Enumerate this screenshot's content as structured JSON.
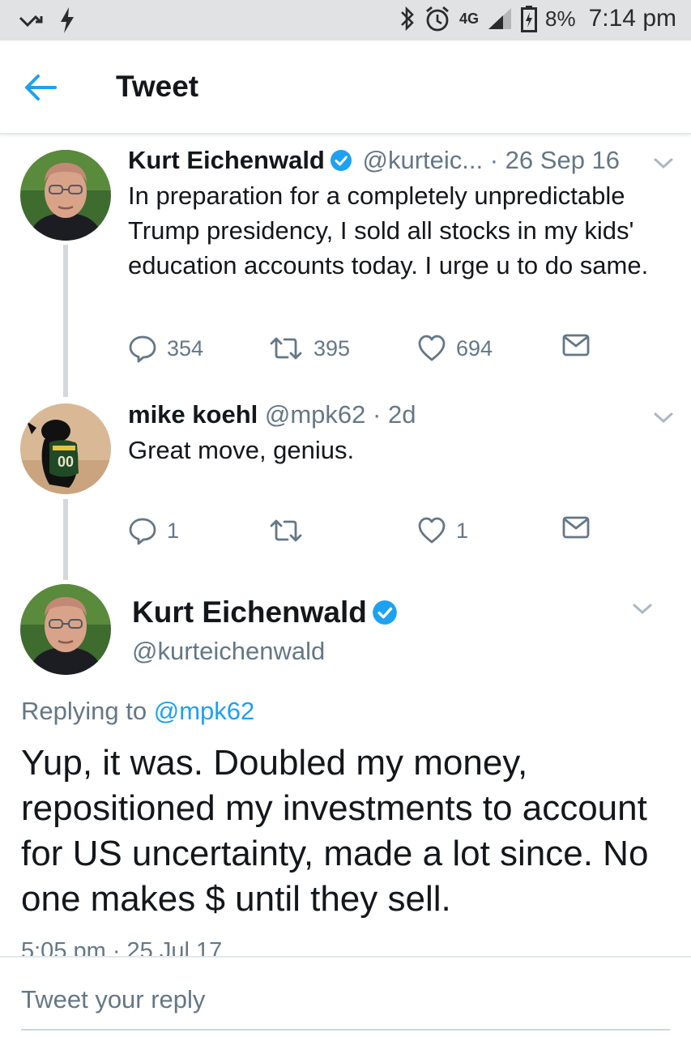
{
  "status_bar": {
    "network": "4G",
    "battery_percent": "8%",
    "time": "7:14 pm",
    "icons": [
      "missed-call-icon",
      "flash-icon",
      "bluetooth-icon",
      "alarm-icon",
      "signal-icon",
      "battery-icon"
    ]
  },
  "header": {
    "title": "Tweet",
    "back_icon": "arrow-left-icon"
  },
  "thread": [
    {
      "name": "Kurt Eichenwald",
      "verified": true,
      "handle": "@kurteic...",
      "date": "· 26 Sep 16",
      "text": "In preparation for a completely unpredictable Trump presidency, I sold all stocks in my kids' education accounts today. I urge u to do same.",
      "replies": "354",
      "retweets": "395",
      "likes": "694"
    },
    {
      "name": "mike koehl",
      "verified": false,
      "handle": "@mpk62",
      "date": "· 2d",
      "text": "Great move, genius.",
      "replies": "1",
      "retweets": "",
      "likes": "1"
    }
  ],
  "focused_tweet": {
    "name": "Kurt Eichenwald",
    "handle": "@kurteichenwald",
    "replying_prefix": "Replying to",
    "replying_to": "@mpk62",
    "text": "Yup, it was. Doubled my money, repositioned my investments to account for US uncertainty, made a lot since. No one makes $ until they sell.",
    "timestamp": "5:05 pm · 25 Jul 17"
  },
  "reply_bar": {
    "placeholder": "Tweet your reply"
  },
  "colors": {
    "accent": "#1da1f2",
    "text": "#14171a",
    "secondary": "#657786",
    "status_bar_bg": "#e1e2e4"
  }
}
